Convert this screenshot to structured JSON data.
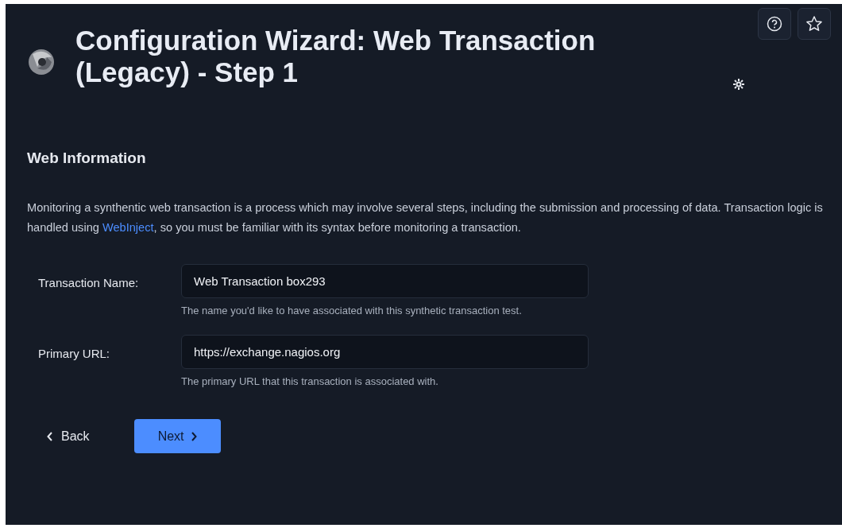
{
  "header": {
    "title": "Configuration Wizard: Web Transaction (Legacy) - Step 1"
  },
  "section": {
    "heading": "Web Information",
    "intro_before": "Monitoring a synthentic web transaction is a process which may involve several steps, including the submission and processing of data. Transaction logic is handled using ",
    "intro_link": "WebInject",
    "intro_after": ", so you must be familiar with its syntax before monitoring a transaction."
  },
  "fields": [
    {
      "label": "Transaction Name:",
      "value": "Web Transaction box293",
      "help": "The name you'd like to have associated with this synthetic transaction test."
    },
    {
      "label": "Primary URL:",
      "value": "https://exchange.nagios.org",
      "help": "The primary URL that this transaction is associated with."
    }
  ],
  "buttons": [
    {
      "kind": "back",
      "label": "Back"
    },
    {
      "kind": "next",
      "label": "Next"
    }
  ]
}
